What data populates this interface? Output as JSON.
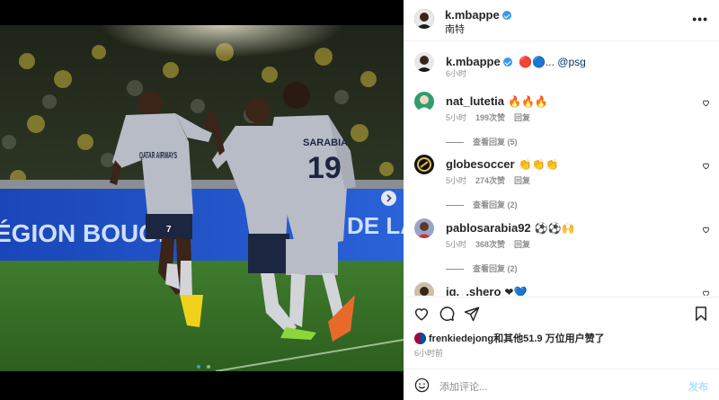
{
  "post": {
    "username": "k.mbappe",
    "location": "南特",
    "caption_emojis": "🔴🔵...",
    "caption_mention": "@psg",
    "caption_time": "6小时",
    "likes_text": "frenkiedejong和其他51.9 万位用户赞了",
    "posted_time": "6小时前"
  },
  "comments": [
    {
      "user": "nat_lutetia",
      "text": "🔥🔥🔥",
      "time": "5小时",
      "likes": "199次赞",
      "reply": "回复",
      "view_replies": "查看回复 (5)"
    },
    {
      "user": "globesoccer",
      "text": "👏👏👏",
      "time": "5小时",
      "likes": "274次赞",
      "reply": "回复",
      "view_replies": "查看回复 (2)"
    },
    {
      "user": "pablosarabia92",
      "text": "⚽⚽🙌",
      "time": "5小时",
      "likes": "368次赞",
      "reply": "回复",
      "view_replies": "查看回复 (2)"
    },
    {
      "user": "iq._.shero",
      "text": "❤💙"
    }
  ],
  "add_comment": {
    "placeholder": "添加评论...",
    "post_label": "发布"
  },
  "photo": {
    "jersey_number": "19",
    "jersey_name": "SARABIA",
    "shirt_sponsor": "QATAR AIRWAYS",
    "banner_text": "ÉGION BOUGE",
    "banner_text_right": "DE LA",
    "mbappe_number": "7"
  },
  "icons": [
    "heart-icon",
    "comment-icon",
    "share-icon",
    "bookmark-icon",
    "emoji-icon",
    "more-icon",
    "verified-icon",
    "next-arrow-icon"
  ],
  "colors": {
    "accent": "#3897f0",
    "banner": "#1d4fc4",
    "pitch": "#3e7a2c",
    "kit": "#b8bcc6"
  }
}
